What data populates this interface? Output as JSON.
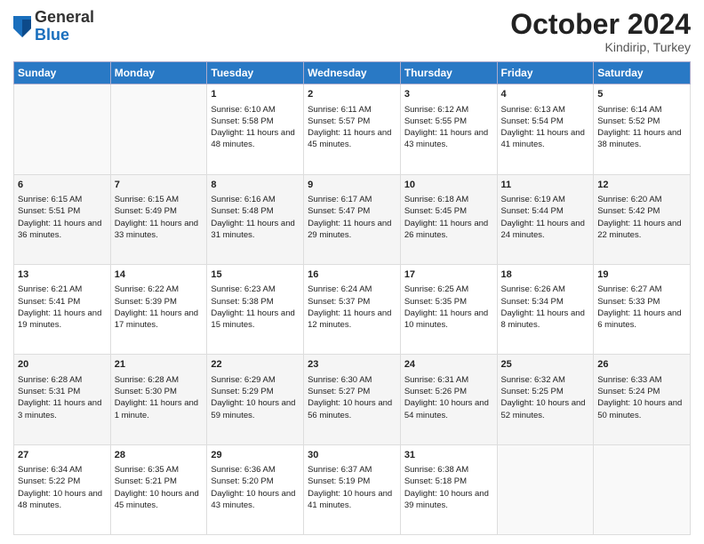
{
  "header": {
    "logo_line1": "General",
    "logo_line2": "Blue",
    "month": "October 2024",
    "location": "Kindirip, Turkey"
  },
  "weekdays": [
    "Sunday",
    "Monday",
    "Tuesday",
    "Wednesday",
    "Thursday",
    "Friday",
    "Saturday"
  ],
  "weeks": [
    [
      {
        "day": "",
        "info": ""
      },
      {
        "day": "",
        "info": ""
      },
      {
        "day": "1",
        "info": "Sunrise: 6:10 AM\nSunset: 5:58 PM\nDaylight: 11 hours and 48 minutes."
      },
      {
        "day": "2",
        "info": "Sunrise: 6:11 AM\nSunset: 5:57 PM\nDaylight: 11 hours and 45 minutes."
      },
      {
        "day": "3",
        "info": "Sunrise: 6:12 AM\nSunset: 5:55 PM\nDaylight: 11 hours and 43 minutes."
      },
      {
        "day": "4",
        "info": "Sunrise: 6:13 AM\nSunset: 5:54 PM\nDaylight: 11 hours and 41 minutes."
      },
      {
        "day": "5",
        "info": "Sunrise: 6:14 AM\nSunset: 5:52 PM\nDaylight: 11 hours and 38 minutes."
      }
    ],
    [
      {
        "day": "6",
        "info": "Sunrise: 6:15 AM\nSunset: 5:51 PM\nDaylight: 11 hours and 36 minutes."
      },
      {
        "day": "7",
        "info": "Sunrise: 6:15 AM\nSunset: 5:49 PM\nDaylight: 11 hours and 33 minutes."
      },
      {
        "day": "8",
        "info": "Sunrise: 6:16 AM\nSunset: 5:48 PM\nDaylight: 11 hours and 31 minutes."
      },
      {
        "day": "9",
        "info": "Sunrise: 6:17 AM\nSunset: 5:47 PM\nDaylight: 11 hours and 29 minutes."
      },
      {
        "day": "10",
        "info": "Sunrise: 6:18 AM\nSunset: 5:45 PM\nDaylight: 11 hours and 26 minutes."
      },
      {
        "day": "11",
        "info": "Sunrise: 6:19 AM\nSunset: 5:44 PM\nDaylight: 11 hours and 24 minutes."
      },
      {
        "day": "12",
        "info": "Sunrise: 6:20 AM\nSunset: 5:42 PM\nDaylight: 11 hours and 22 minutes."
      }
    ],
    [
      {
        "day": "13",
        "info": "Sunrise: 6:21 AM\nSunset: 5:41 PM\nDaylight: 11 hours and 19 minutes."
      },
      {
        "day": "14",
        "info": "Sunrise: 6:22 AM\nSunset: 5:39 PM\nDaylight: 11 hours and 17 minutes."
      },
      {
        "day": "15",
        "info": "Sunrise: 6:23 AM\nSunset: 5:38 PM\nDaylight: 11 hours and 15 minutes."
      },
      {
        "day": "16",
        "info": "Sunrise: 6:24 AM\nSunset: 5:37 PM\nDaylight: 11 hours and 12 minutes."
      },
      {
        "day": "17",
        "info": "Sunrise: 6:25 AM\nSunset: 5:35 PM\nDaylight: 11 hours and 10 minutes."
      },
      {
        "day": "18",
        "info": "Sunrise: 6:26 AM\nSunset: 5:34 PM\nDaylight: 11 hours and 8 minutes."
      },
      {
        "day": "19",
        "info": "Sunrise: 6:27 AM\nSunset: 5:33 PM\nDaylight: 11 hours and 6 minutes."
      }
    ],
    [
      {
        "day": "20",
        "info": "Sunrise: 6:28 AM\nSunset: 5:31 PM\nDaylight: 11 hours and 3 minutes."
      },
      {
        "day": "21",
        "info": "Sunrise: 6:28 AM\nSunset: 5:30 PM\nDaylight: 11 hours and 1 minute."
      },
      {
        "day": "22",
        "info": "Sunrise: 6:29 AM\nSunset: 5:29 PM\nDaylight: 10 hours and 59 minutes."
      },
      {
        "day": "23",
        "info": "Sunrise: 6:30 AM\nSunset: 5:27 PM\nDaylight: 10 hours and 56 minutes."
      },
      {
        "day": "24",
        "info": "Sunrise: 6:31 AM\nSunset: 5:26 PM\nDaylight: 10 hours and 54 minutes."
      },
      {
        "day": "25",
        "info": "Sunrise: 6:32 AM\nSunset: 5:25 PM\nDaylight: 10 hours and 52 minutes."
      },
      {
        "day": "26",
        "info": "Sunrise: 6:33 AM\nSunset: 5:24 PM\nDaylight: 10 hours and 50 minutes."
      }
    ],
    [
      {
        "day": "27",
        "info": "Sunrise: 6:34 AM\nSunset: 5:22 PM\nDaylight: 10 hours and 48 minutes."
      },
      {
        "day": "28",
        "info": "Sunrise: 6:35 AM\nSunset: 5:21 PM\nDaylight: 10 hours and 45 minutes."
      },
      {
        "day": "29",
        "info": "Sunrise: 6:36 AM\nSunset: 5:20 PM\nDaylight: 10 hours and 43 minutes."
      },
      {
        "day": "30",
        "info": "Sunrise: 6:37 AM\nSunset: 5:19 PM\nDaylight: 10 hours and 41 minutes."
      },
      {
        "day": "31",
        "info": "Sunrise: 6:38 AM\nSunset: 5:18 PM\nDaylight: 10 hours and 39 minutes."
      },
      {
        "day": "",
        "info": ""
      },
      {
        "day": "",
        "info": ""
      }
    ]
  ]
}
